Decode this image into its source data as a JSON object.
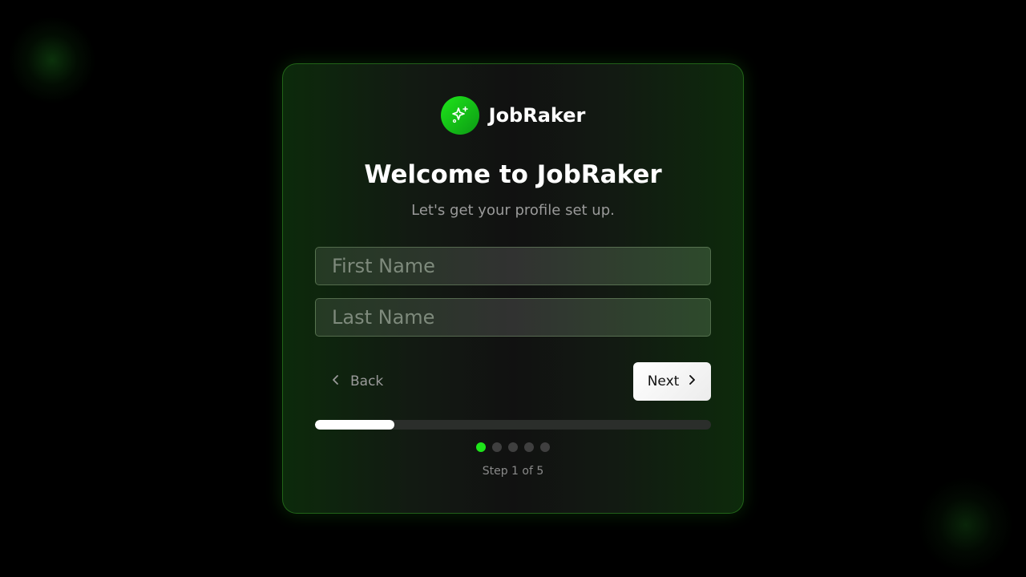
{
  "brand": {
    "name": "JobRaker",
    "logo_icon": "sparkles-icon",
    "accent": "#1ee51a"
  },
  "welcome": {
    "title": "Welcome to JobRaker",
    "subtitle": "Let's get your profile set up."
  },
  "form": {
    "first_name": {
      "value": "",
      "placeholder": "First Name"
    },
    "last_name": {
      "value": "",
      "placeholder": "Last Name"
    }
  },
  "nav": {
    "back_label": "Back",
    "back_icon": "chevron-left-icon",
    "next_label": "Next",
    "next_icon": "chevron-right-icon"
  },
  "progress": {
    "fraction": 0.2,
    "current_step": 1,
    "total_steps": 5,
    "step_text": "Step 1 of 5"
  }
}
